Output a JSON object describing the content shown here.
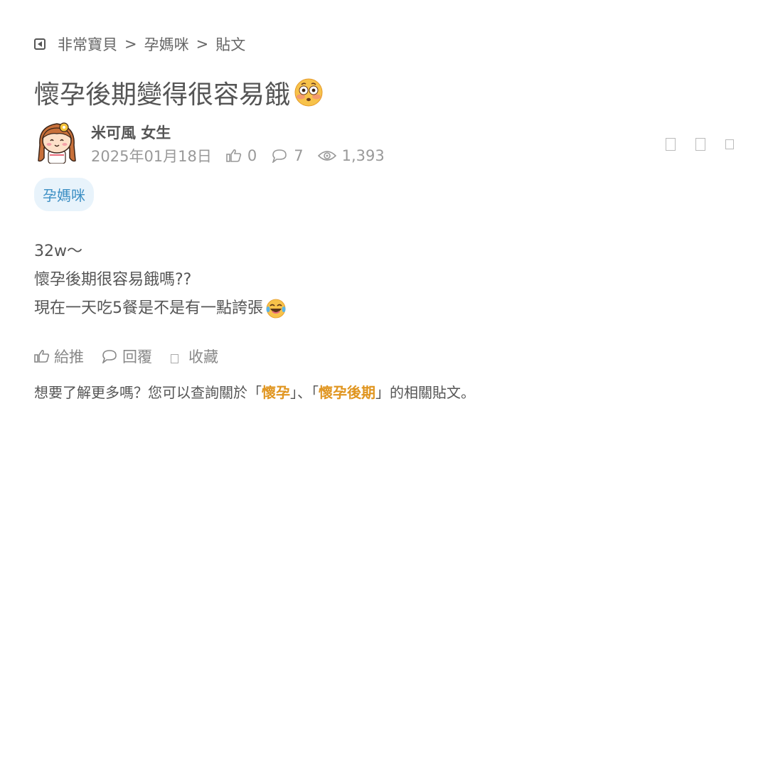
{
  "breadcrumb": {
    "items": [
      "非常寶貝",
      "孕媽咪",
      "貼文"
    ],
    "separator": ">"
  },
  "post": {
    "title": "懷孕後期變得很容易餓",
    "author": {
      "name": "米可風 女生"
    },
    "date": "2025年01月18日",
    "likes": "0",
    "comments": "7",
    "views": "1,393",
    "tag": "孕媽咪",
    "body_lines": [
      "32w～",
      "懷孕後期很容易餓嗎??",
      "現在一天吃5餐是不是有一點誇張"
    ]
  },
  "actions": {
    "like": "給推",
    "reply": "回覆",
    "save": "收藏"
  },
  "related": {
    "prefix": "想要了解更多嗎？您可以查詢關於「",
    "kw1": "懷孕",
    "mid": "」、「",
    "kw2": "懷孕後期",
    "suffix": "」的相關貼文。"
  },
  "colors": {
    "tag_bg": "#e8f3fb",
    "tag_text": "#3c8fc4",
    "keyword": "#e0951f"
  }
}
